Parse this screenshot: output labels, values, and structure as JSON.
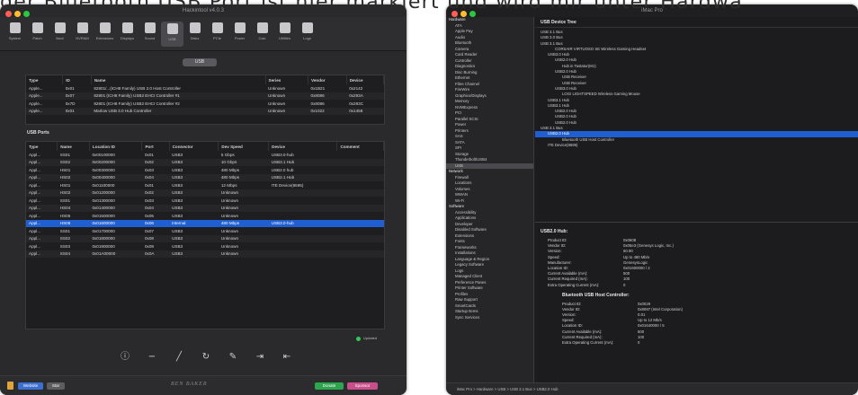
{
  "caption": {
    "line1": "der Bluetooth USB Port ist hier markiert und wird mir unter Hardwa",
    "line2": "r"
  },
  "left_window": {
    "title": "Hackintool v4.0.3",
    "toolbar": [
      {
        "label": "System",
        "icon": "system-icon"
      },
      {
        "label": "Patch",
        "icon": "patch-icon"
      },
      {
        "label": "Boot",
        "icon": "boot-icon"
      },
      {
        "label": "NVRAM",
        "icon": "nvram-icon"
      },
      {
        "label": "Extensions",
        "icon": "extensions-icon"
      },
      {
        "label": "Displays",
        "icon": "displays-icon"
      },
      {
        "label": "Sound",
        "icon": "sound-icon"
      },
      {
        "label": "USB",
        "icon": "usb-icon"
      },
      {
        "label": "Disks",
        "icon": "disks-icon"
      },
      {
        "label": "PCIe",
        "icon": "pcie-icon"
      },
      {
        "label": "Power",
        "icon": "power-icon"
      },
      {
        "label": "Calc",
        "icon": "calc-icon"
      },
      {
        "label": "Utilities",
        "icon": "utilities-icon"
      },
      {
        "label": "Logs",
        "icon": "logs-icon"
      }
    ],
    "usb_pill": "USB",
    "controllers": {
      "headers": [
        "Type",
        "ID",
        "Name",
        "Series",
        "Vendor",
        "Device"
      ],
      "rows": [
        [
          "Apple...",
          "0x01",
          "82801/...(ICH8 Family) USB 2.0 Host Controller",
          "Unknown",
          "0x1B21",
          "0x2142"
        ],
        [
          "Apple...",
          "0x07",
          "82801 (ICH8 Family) USB2 EHCI Controller #1",
          "Unknown",
          "0x8086",
          "0x293A"
        ],
        [
          "Apple...",
          "0x7D",
          "82801 (ICH8 Family) USB2 EHCI Controller #2",
          "Unknown",
          "0x8086",
          "0x293C"
        ],
        [
          "Apple...",
          "0x01",
          "Marlow USB 3.0 Hub Controller",
          "Unknown",
          "0x1022",
          "0x1458"
        ]
      ]
    },
    "ports_title": "USB Ports",
    "ports": {
      "headers": [
        "Type",
        "Name",
        "Location ID",
        "Port",
        "Connector",
        "Dev Speed",
        "Device",
        "Comment"
      ],
      "rows": [
        [
          "Appl...",
          "SS01",
          "0x00100000",
          "0x01",
          "USB3",
          "5 Gbps",
          "USB3.0-hub",
          ""
        ],
        [
          "Appl...",
          "SS02",
          "0x00200000",
          "0x02",
          "USB3",
          "10 Gbps",
          "USB3.1 Hub",
          ""
        ],
        [
          "Appl...",
          "HS01",
          "0x00300000",
          "0x03",
          "USB3",
          "480 Mbps",
          "USB2.0 hub",
          ""
        ],
        [
          "Appl...",
          "HS02",
          "0x00400000",
          "0x04",
          "USB3",
          "480 Mbps",
          "USB2.1 Hub",
          ""
        ],
        [
          "Appl...",
          "HS01",
          "0x01100000",
          "0x01",
          "USB3",
          "12 Mbps",
          "ITE Device(8595)",
          ""
        ],
        [
          "Appl...",
          "HS02",
          "0x01200000",
          "0x02",
          "USB3",
          "Unknown",
          "",
          ""
        ],
        [
          "Appl...",
          "SS01",
          "0x01300000",
          "0x03",
          "USB3",
          "Unknown",
          "",
          ""
        ],
        [
          "Appl...",
          "HS04",
          "0x01400000",
          "0x04",
          "USB3",
          "Unknown",
          "",
          ""
        ],
        [
          "Appl...",
          "HS05",
          "0x01500000",
          "0x05",
          "USB3",
          "Unknown",
          "",
          ""
        ],
        [
          "Appl...",
          "HS06",
          "0x01600000",
          "0x06",
          "Internal",
          "480 Mbps",
          "USB3.0-hub",
          ""
        ],
        [
          "Appl...",
          "SS01",
          "0x01700000",
          "0x07",
          "USB3",
          "Unknown",
          "",
          ""
        ],
        [
          "Appl...",
          "SS02",
          "0x01800000",
          "0x08",
          "USB3",
          "Unknown",
          "",
          ""
        ],
        [
          "Appl...",
          "SS03",
          "0x01900000",
          "0x09",
          "USB3",
          "Unknown",
          "",
          ""
        ],
        [
          "Appl...",
          "SS04",
          "0x01A00000",
          "0x0A",
          "USB3",
          "Unknown",
          "",
          ""
        ]
      ],
      "selected_index": 9
    },
    "status": "Updated",
    "brand": "BEN BAKER",
    "footer_buttons": {
      "website": "Website",
      "star": "Star",
      "donate": "Donate",
      "sponsor": "Sponsor"
    },
    "colors": {
      "selection": "#1f5fd1",
      "green": "#30c85a"
    }
  },
  "right_window": {
    "title": "iMac Pro",
    "sidebar": [
      {
        "label": "Hardware",
        "group": true
      },
      {
        "label": "ATA"
      },
      {
        "label": "Apple Pay"
      },
      {
        "label": "Audio"
      },
      {
        "label": "Bluetooth"
      },
      {
        "label": "Camera"
      },
      {
        "label": "Card Reader"
      },
      {
        "label": "Controller"
      },
      {
        "label": "Diagnostics"
      },
      {
        "label": "Disc Burning"
      },
      {
        "label": "Ethernet"
      },
      {
        "label": "Fibre Channel"
      },
      {
        "label": "FireWire"
      },
      {
        "label": "Graphics/Displays"
      },
      {
        "label": "Memory"
      },
      {
        "label": "NVMExpress"
      },
      {
        "label": "PCI"
      },
      {
        "label": "Parallel SCSI"
      },
      {
        "label": "Power"
      },
      {
        "label": "Printers"
      },
      {
        "label": "SAS"
      },
      {
        "label": "SATA"
      },
      {
        "label": "SPI"
      },
      {
        "label": "Storage"
      },
      {
        "label": "Thunderbolt/USB4"
      },
      {
        "label": "USB",
        "sel": true
      },
      {
        "label": "Network",
        "group": true
      },
      {
        "label": "Firewall"
      },
      {
        "label": "Locations"
      },
      {
        "label": "Volumes"
      },
      {
        "label": "WWAN"
      },
      {
        "label": "Wi-Fi"
      },
      {
        "label": "Software",
        "group": true
      },
      {
        "label": "Accessibility"
      },
      {
        "label": "Applications"
      },
      {
        "label": "Developer"
      },
      {
        "label": "Disabled Software"
      },
      {
        "label": "Extensions"
      },
      {
        "label": "Fonts"
      },
      {
        "label": "Frameworks"
      },
      {
        "label": "Installations"
      },
      {
        "label": "Language & Region"
      },
      {
        "label": "Legacy Software"
      },
      {
        "label": "Logs"
      },
      {
        "label": "Managed Client"
      },
      {
        "label": "Preference Panes"
      },
      {
        "label": "Printer Software"
      },
      {
        "label": "Profiles"
      },
      {
        "label": "Raw Support"
      },
      {
        "label": "SmartCards"
      },
      {
        "label": "Startup Items"
      },
      {
        "label": "Sync Services"
      }
    ],
    "tree_title": "USB Device Tree",
    "tree": [
      {
        "label": "USB 3.1 Bus",
        "indent": 0
      },
      {
        "label": "USB 3.0 Bus",
        "indent": 0
      },
      {
        "label": "USB 3.1 Bus",
        "indent": 0
      },
      {
        "label": "CORSAIR VIRTUOSO SE Wireless Gaming Headset",
        "indent": 2
      },
      {
        "label": "USB3.0 Hub",
        "indent": 1
      },
      {
        "label": "USB2.0 Hub",
        "indent": 2
      },
      {
        "label": "Hub in Tastatur(M1)",
        "indent": 3
      },
      {
        "label": "USB2.0 Hub",
        "indent": 2
      },
      {
        "label": "USB Receiver",
        "indent": 3
      },
      {
        "label": "USB Receiver",
        "indent": 3
      },
      {
        "label": "USB3.0 Hub",
        "indent": 2
      },
      {
        "label": "LOGI LIGHTSPEED Wireless Gaming Mouse",
        "indent": 3
      },
      {
        "label": "USB3.1 Hub",
        "indent": 1
      },
      {
        "label": "USB3.1 Hub",
        "indent": 1
      },
      {
        "label": "USB2.0 Hub",
        "indent": 2
      },
      {
        "label": "USB2.0 Hub",
        "indent": 2
      },
      {
        "label": "USB2.0 Hub",
        "indent": 2
      },
      {
        "label": "USB 3.1 Bus",
        "indent": 0
      },
      {
        "label": "USB2.0 Hub",
        "indent": 1,
        "sel": true
      },
      {
        "label": "Bluetooth USB Host Controller",
        "indent": 3
      },
      {
        "label": "ITE Device(8595)",
        "indent": 1
      }
    ],
    "detail_title": "USB2.0 Hub:",
    "detail": [
      [
        "Product ID:",
        "0x0608"
      ],
      [
        "Vendor ID:",
        "0x05e3 (Genesys Logic, Inc.)"
      ],
      [
        "Version:",
        "60.90"
      ],
      [
        "Speed:",
        "Up to 480 Mb/s"
      ],
      [
        "Manufacturer:",
        "GenesysLogic"
      ],
      [
        "Location ID:",
        "0x01600000 / 2"
      ],
      [
        "Current Available (mA):",
        "500"
      ],
      [
        "Current Required (mA):",
        "100"
      ],
      [
        "Extra Operating Current (mA):",
        "0"
      ]
    ],
    "sub_title": "Bluetooth USB Host Controller:",
    "sub_detail": [
      [
        "Product ID:",
        "0x0029"
      ],
      [
        "Vendor ID:",
        "0x8087 (Intel Corporation)"
      ],
      [
        "Version:",
        "0.01"
      ],
      [
        "Speed:",
        "Up to 12 Mb/s"
      ],
      [
        "Location ID:",
        "0x01640000 / 5"
      ],
      [
        "Current Available (mA):",
        "500"
      ],
      [
        "Current Required (mA):",
        "100"
      ],
      [
        "Extra Operating Current (mA):",
        "0"
      ]
    ],
    "path": "iMac Pro > Hardware > USB > USB 3.1 Bus > USB2.0 Hub"
  }
}
